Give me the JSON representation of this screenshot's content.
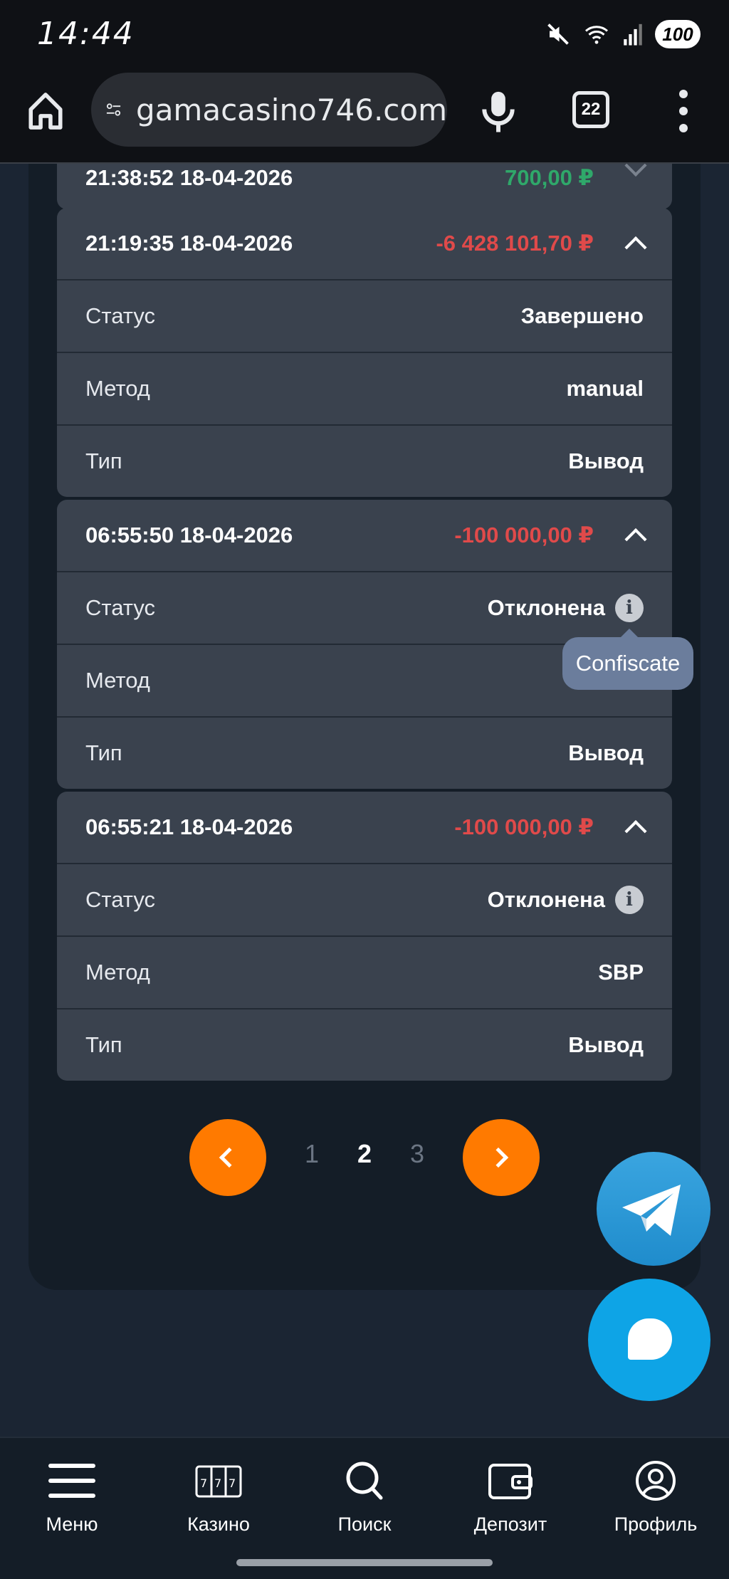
{
  "status_bar": {
    "time": "14:44",
    "battery": "100"
  },
  "browser": {
    "url": "gamacasino746.com",
    "tab_count": "22"
  },
  "transactions": [
    {
      "datetime": "21:38:52 18-04-2026",
      "amount": "700,00 ₽",
      "expanded": false
    },
    {
      "datetime": "21:19:35 18-04-2026",
      "amount": "-6 428 101,70 ₽",
      "expanded": true,
      "rows": [
        {
          "label": "Статус",
          "value": "Завершено"
        },
        {
          "label": "Метод",
          "value": "manual"
        },
        {
          "label": "Тип",
          "value": "Вывод"
        }
      ]
    },
    {
      "datetime": "06:55:50 18-04-2026",
      "amount": "-100 000,00 ₽",
      "expanded": true,
      "rows": [
        {
          "label": "Статус",
          "value": "Отклонена",
          "info": true
        },
        {
          "label": "Метод",
          "value": ""
        },
        {
          "label": "Тип",
          "value": "Вывод"
        }
      ]
    },
    {
      "datetime": "06:55:21 18-04-2026",
      "amount": "-100 000,00 ₽",
      "expanded": true,
      "rows": [
        {
          "label": "Статус",
          "value": "Отклонена",
          "info": true
        },
        {
          "label": "Метод",
          "value": "SBP"
        },
        {
          "label": "Тип",
          "value": "Вывод"
        }
      ]
    }
  ],
  "tooltip": "Confiscate",
  "pagination": {
    "pages": [
      "1",
      "2",
      "3"
    ],
    "current": "2"
  },
  "bottom_nav": [
    {
      "label": "Меню",
      "icon": "menu-icon"
    },
    {
      "label": "Казино",
      "icon": "slot-machine-icon"
    },
    {
      "label": "Поиск",
      "icon": "search-icon"
    },
    {
      "label": "Депозит",
      "icon": "wallet-icon"
    },
    {
      "label": "Профиль",
      "icon": "profile-icon"
    }
  ],
  "colors": {
    "accent": "#ff7a00",
    "negative": "#e04a4a",
    "positive": "#2fa86a",
    "card": "#3a424e"
  }
}
